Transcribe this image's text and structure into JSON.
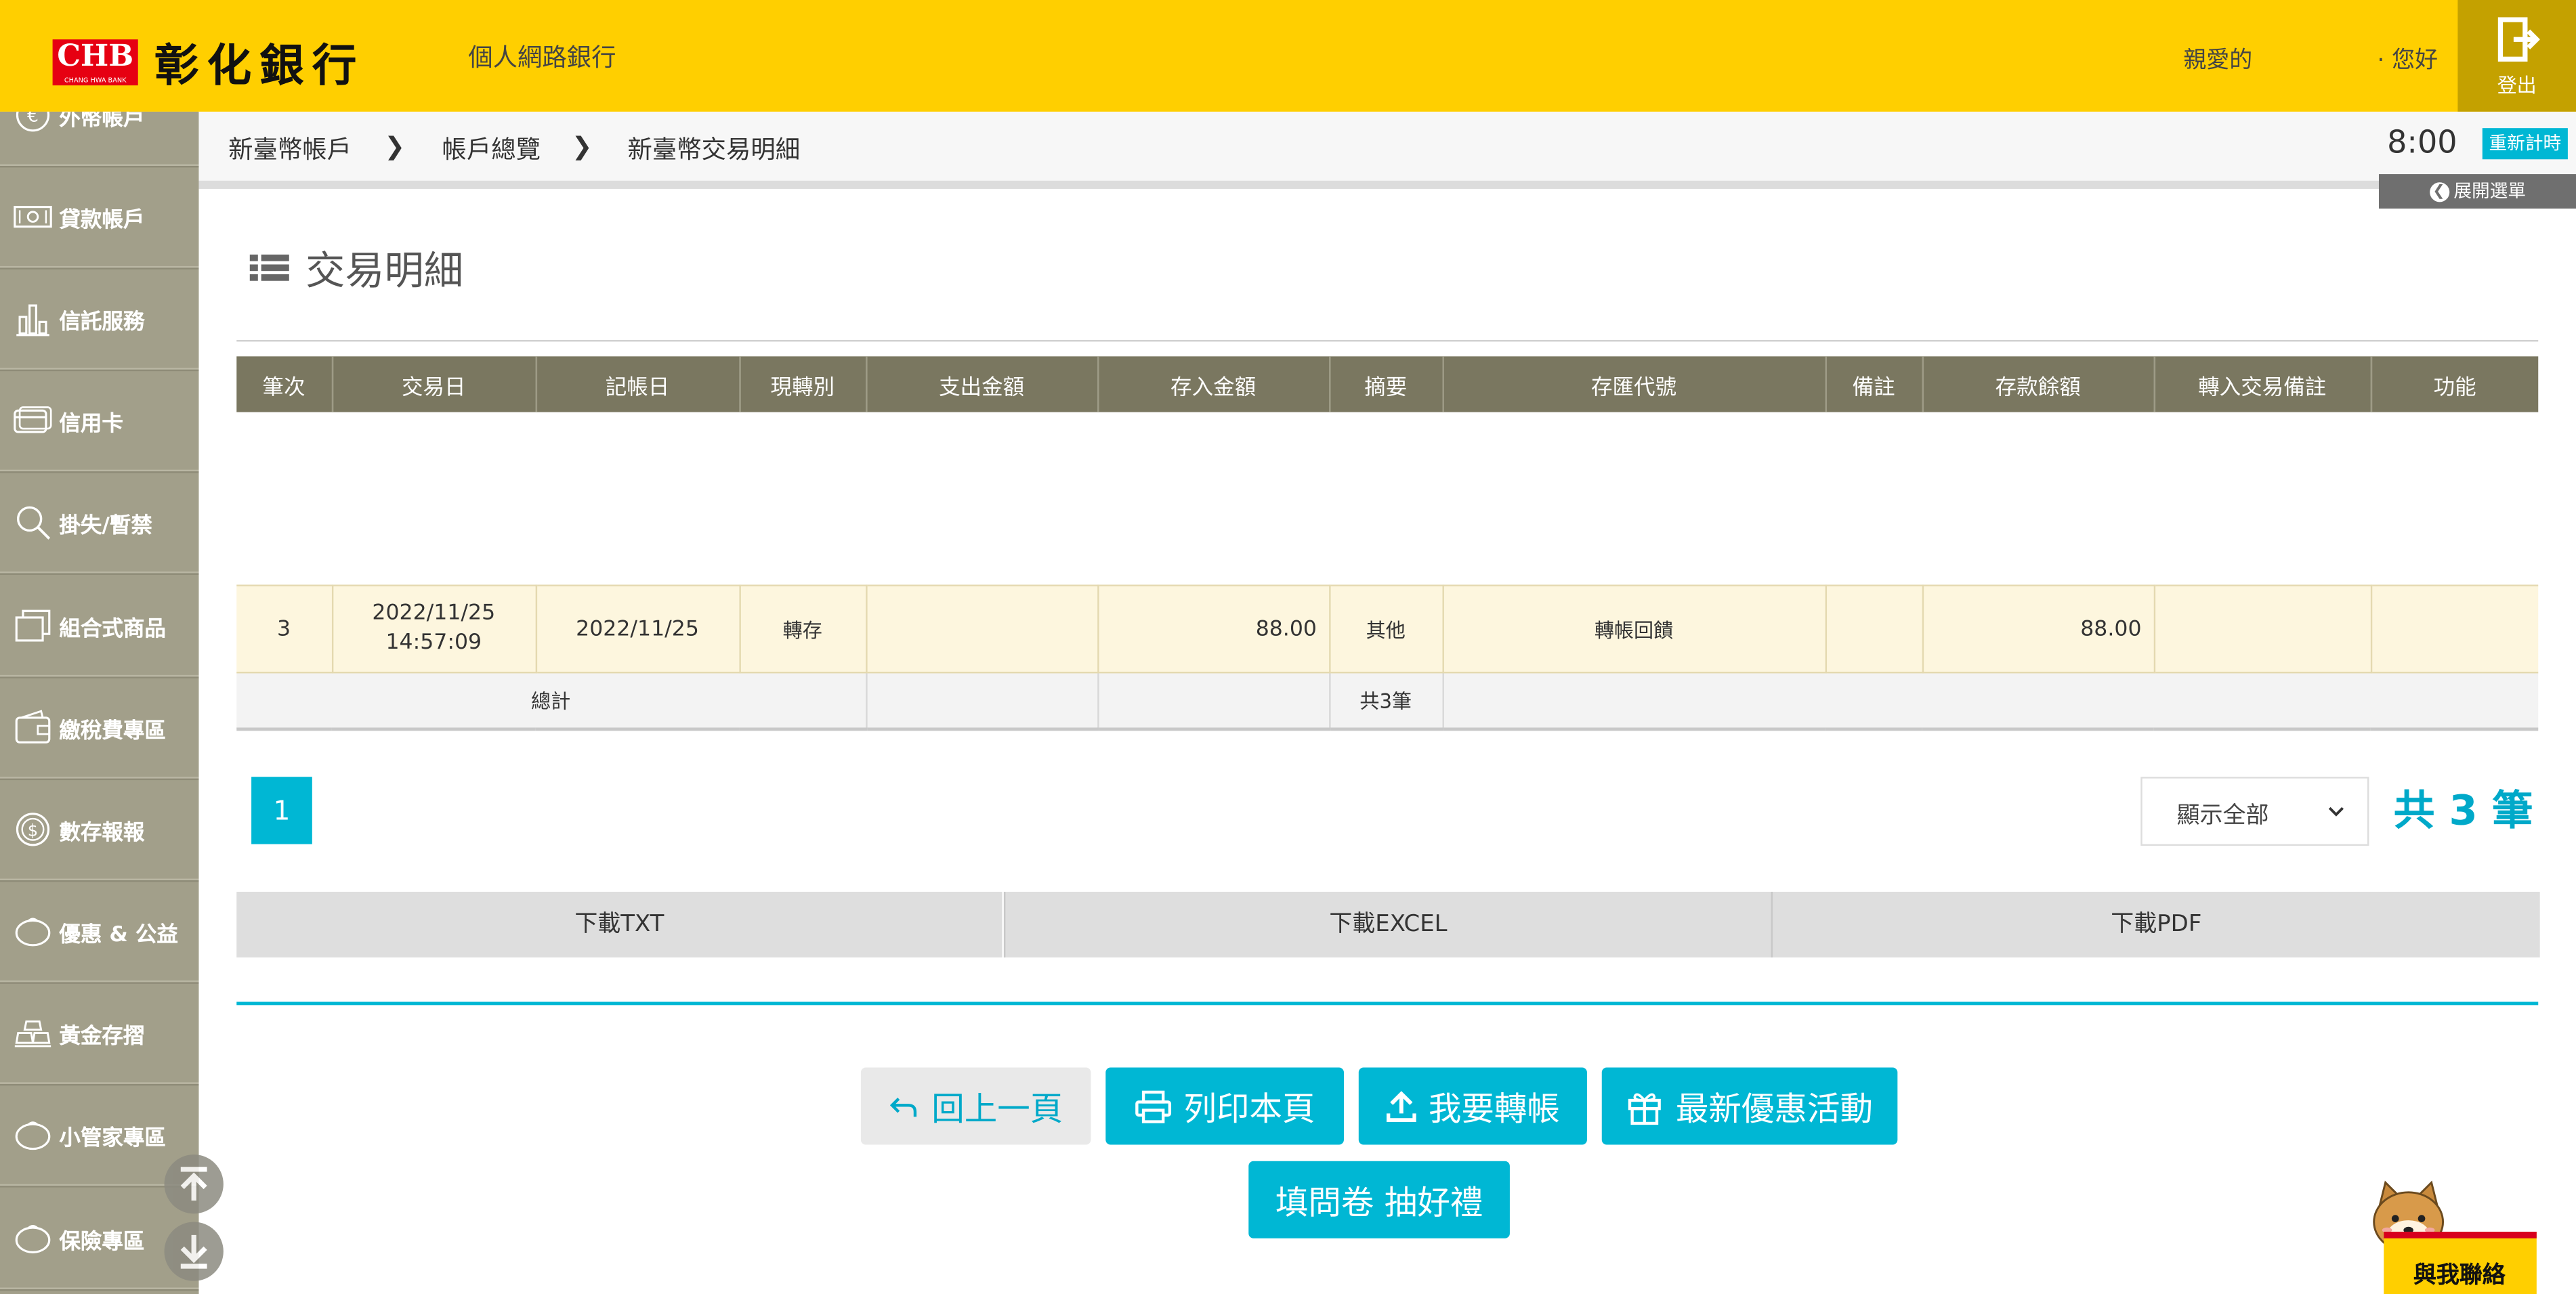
{
  "header": {
    "logo_text": "CHB",
    "logo_subtext": "CHANG HWA BANK",
    "logo_cn": "彰化銀行",
    "site_title": "個人網路銀行",
    "greeting": "親愛的",
    "greeting_suffix": "· 您好",
    "logout_label": "登出",
    "brand_color": "#ffcf00"
  },
  "sidebar": {
    "items": [
      {
        "label": "外幣帳戶",
        "icon": "euro-icon"
      },
      {
        "label": "貸款帳戶",
        "icon": "banknote-icon"
      },
      {
        "label": "信託服務",
        "icon": "bar-chart-icon"
      },
      {
        "label": "信用卡",
        "icon": "credit-card-icon"
      },
      {
        "label": "掛失/暫禁",
        "icon": "magnifier-icon"
      },
      {
        "label": "組合式商品",
        "icon": "cards-icon"
      },
      {
        "label": "繳稅費專區",
        "icon": "wallet-icon"
      },
      {
        "label": "數存報報",
        "icon": "dollar-coin-icon"
      },
      {
        "label": "優惠 & 公益",
        "icon": "piggy-bank-icon"
      },
      {
        "label": "黃金存摺",
        "icon": "gold-bars-icon"
      },
      {
        "label": "小管家專區",
        "icon": "piggy-bank-icon"
      },
      {
        "label": "保險專區",
        "icon": "piggy-bank-icon"
      }
    ]
  },
  "breadcrumb": {
    "items": [
      "新臺幣帳戶",
      "帳戶總覽",
      "新臺幣交易明細"
    ]
  },
  "session": {
    "timer": "8:00",
    "renew_label": "重新計時",
    "expand_label": "展開選單"
  },
  "page": {
    "title": "交易明細"
  },
  "table": {
    "columns": [
      "筆次",
      "交易日",
      "記帳日",
      "現轉別",
      "支出金額",
      "存入金額",
      "摘要",
      "存匯代號",
      "備註",
      "存款餘額",
      "轉入交易備註",
      "功能"
    ],
    "rows": [
      {
        "seq": "3",
        "trade_date": "2022/11/25",
        "trade_time": "14:57:09",
        "post_date": "2022/11/25",
        "type": "轉存",
        "debit": "",
        "credit": "88.00",
        "summary": "其他",
        "code": "轉帳回饋",
        "note": "",
        "balance": "88.00",
        "transfer_note": "",
        "action": ""
      }
    ],
    "summary": {
      "label": "總計",
      "debit_total": "",
      "credit_total": "",
      "count": "共3筆"
    }
  },
  "pagination": {
    "current_page": "1",
    "display_option": "顯示全部",
    "total_text": "共 3 筆"
  },
  "downloads": {
    "txt": "下載TXT",
    "excel": "下載EXCEL",
    "pdf": "下載PDF"
  },
  "actions": {
    "back": "回上一頁",
    "print": "列印本頁",
    "transfer": "我要轉帳",
    "promo": "最新優惠活動",
    "survey": "填問卷 抽好禮"
  },
  "contact": {
    "label": "與我聯絡"
  },
  "colors": {
    "accent": "#00b7d4",
    "table_header": "#7a7760",
    "sidebar": "#a29f8a",
    "row_highlight": "#fdf6de"
  }
}
